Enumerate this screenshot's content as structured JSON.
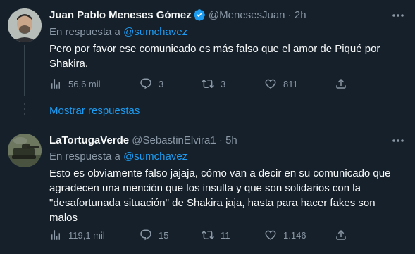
{
  "tweets": [
    {
      "display_name": "Juan Pablo Meneses Gómez",
      "verified": true,
      "handle": "@MenesesJuan",
      "separator": "·",
      "time": "2h",
      "reply_prefix": "En respuesta a",
      "reply_mention": "@sumchavez",
      "text": "Pero por favor ese comunicado es más falso que el amor de Piqué por Shakira.",
      "views": "56,6 mil",
      "replies": "3",
      "retweets": "3",
      "likes": "811"
    },
    {
      "display_name": "LaTortugaVerde",
      "verified": false,
      "handle": "@SebastinElvira1",
      "separator": "·",
      "time": "5h",
      "reply_prefix": "En respuesta a",
      "reply_mention": "@sumchavez",
      "text": "Esto es obviamente falso jajaja, cómo van a decir en su comunicado que agradecen una mención que los insulta y que son solidarios con la \"desafortunada situación\" de Shakira jaja, hasta para hacer fakes son malos",
      "views": "119,1 mil",
      "replies": "15",
      "retweets": "11",
      "likes": "1.146"
    }
  ],
  "show_replies_label": "Mostrar respuestas",
  "colors": {
    "background": "#15202b",
    "text": "#f7f9f9",
    "secondary": "#8b98a5",
    "accent": "#1d9bf0",
    "divider": "#38444d"
  },
  "icons": [
    "more-icon",
    "verified-badge-icon",
    "views-icon",
    "reply-icon",
    "retweet-icon",
    "like-icon",
    "share-icon"
  ]
}
